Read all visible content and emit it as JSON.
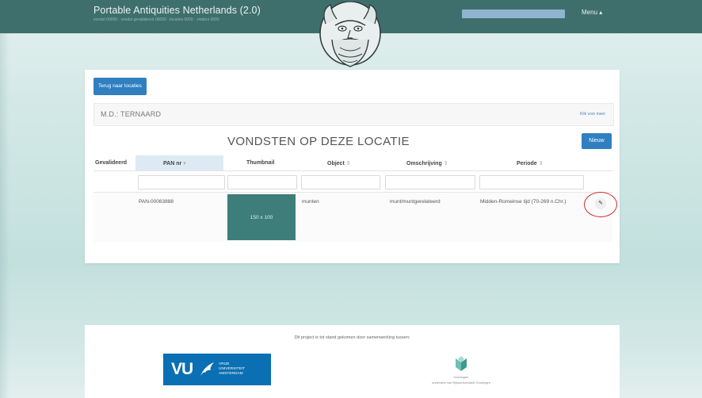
{
  "nav": {
    "brand": "Portable Antiquities Netherlands (2.0)",
    "brand_sub": "vondst 00000 · vondst gevalideerd 00000 · locaties 0000 · vinders 0000",
    "menu_label": "Menu ▴"
  },
  "location": {
    "back_button": "Terug naar locaties",
    "name": "M.D.: TERNAARD",
    "more_link": "Klik voor meer"
  },
  "finds": {
    "title": "VONDSTEN OP DEZE LOCATIE",
    "new_button": "Nieuw",
    "columns": [
      {
        "label": "Gevalideerd",
        "sort": ""
      },
      {
        "label": "PAN nr",
        "sort": "▾"
      },
      {
        "label": "Thumbnail",
        "sort": ""
      },
      {
        "label": "Object",
        "sort": "⇕"
      },
      {
        "label": "Omschrijving",
        "sort": "⇕"
      },
      {
        "label": "Periode",
        "sort": "⇕"
      }
    ],
    "rows": [
      {
        "gevalideerd": "",
        "pan_nr": "PAN-00083888",
        "thumbnail": "150 x 100",
        "object": "munten",
        "omschrijving": "munt/muntgerelateerd",
        "periode": "Midden-Romeinse tijd (70-269 n.Chr.)",
        "edit_icon": "pencil-icon"
      }
    ]
  },
  "footer": {
    "text": "Dit project is tot stand gekomen door samenwerking tussen:",
    "vu_big": "VU",
    "vu_lines": [
      "VRIJE",
      "UNIVERSITEIT",
      "AMSTERDAM"
    ],
    "groningen_line1": "Groningen",
    "groningen_line2": "onderdeel van Rijksuniversiteit Groningen"
  },
  "colors": {
    "topbar": "#3f6f6d",
    "primary": "#2f7fc1",
    "thumb": "#3e7e7a",
    "highlight": "#d42a2a"
  }
}
